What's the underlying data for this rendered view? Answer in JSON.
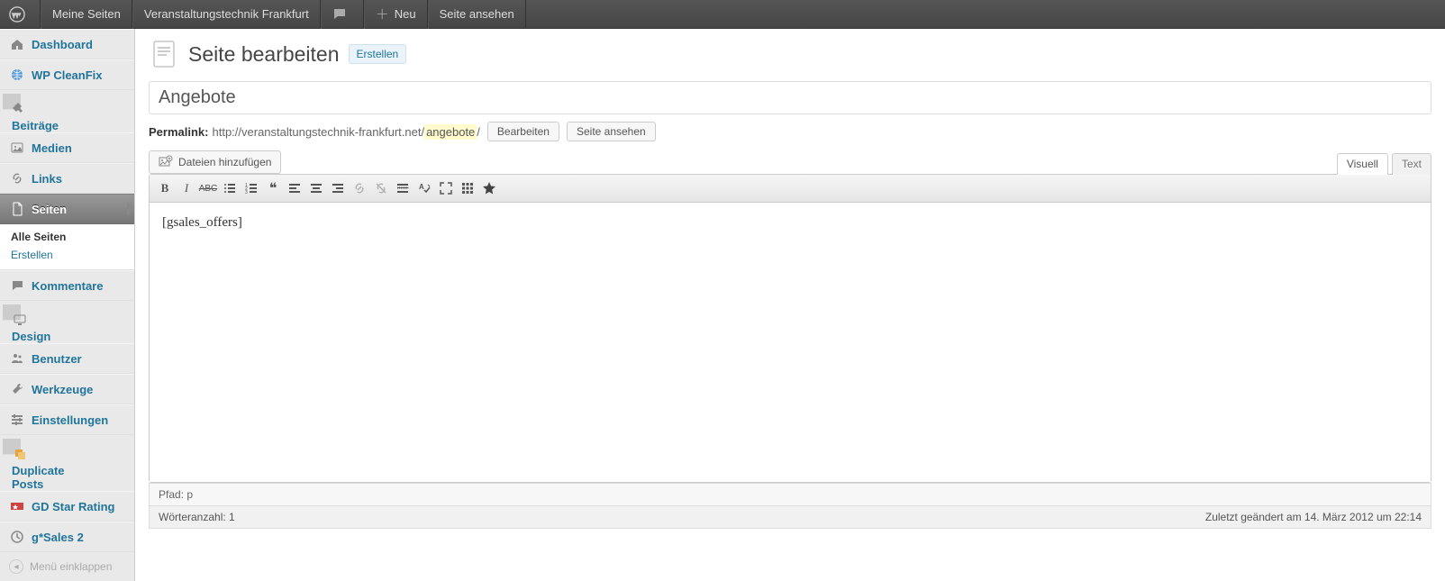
{
  "adminbar": {
    "my_sites": "Meine Seiten",
    "site_name": "Veranstaltungstechnik Frankfurt",
    "new_label": "Neu",
    "view_label": "Seite ansehen"
  },
  "sidebar": {
    "items": [
      {
        "label": "Dashboard",
        "icon": "home"
      },
      {
        "label": "WP CleanFix",
        "icon": "globe"
      },
      {
        "label": "Beiträge",
        "icon": "pin"
      },
      {
        "label": "Medien",
        "icon": "media"
      },
      {
        "label": "Links",
        "icon": "link"
      },
      {
        "label": "Seiten",
        "icon": "page",
        "current": true
      },
      {
        "label": "Kommentare",
        "icon": "comment"
      },
      {
        "label": "Design",
        "icon": "appearance"
      },
      {
        "label": "Benutzer",
        "icon": "users"
      },
      {
        "label": "Werkzeuge",
        "icon": "tools"
      },
      {
        "label": "Einstellungen",
        "icon": "settings"
      },
      {
        "label": "Duplicate Posts",
        "icon": "duplicate"
      },
      {
        "label": "GD Star Rating",
        "icon": "star-rating"
      },
      {
        "label": "g*Sales 2",
        "icon": "gsales"
      }
    ],
    "submenu": {
      "all": "Alle Seiten",
      "new": "Erstellen"
    },
    "collapse": "Menü einklappen"
  },
  "heading": {
    "title": "Seite bearbeiten",
    "add_new": "Erstellen"
  },
  "post": {
    "title": "Angebote"
  },
  "permalink": {
    "label": "Permalink:",
    "base": "http://veranstaltungstechnik-frankfurt.net/",
    "slug": "angebote",
    "trail": "/",
    "edit": "Bearbeiten",
    "view": "Seite ansehen"
  },
  "media_button": "Dateien hinzufügen",
  "tabs": {
    "visual": "Visuell",
    "text": "Text"
  },
  "editor": {
    "content": "[gsales_offers]"
  },
  "path": {
    "label": "Pfad:",
    "value": "p"
  },
  "stats": {
    "wordcount_label": "Wörteranzahl:",
    "wordcount": "1",
    "last_edit": "Zuletzt geändert am 14. März 2012 um 22:14"
  }
}
